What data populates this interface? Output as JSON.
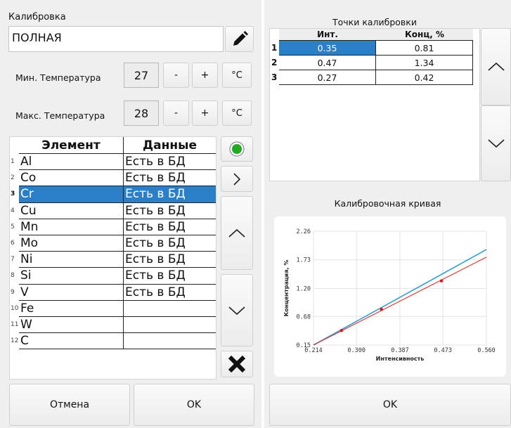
{
  "left": {
    "calibration_label": "Калибровка",
    "calibration_value": "ПОЛНАЯ",
    "min_temp_label": "Мин. Температура",
    "min_temp_value": "27",
    "max_temp_label": "Макс. Температура",
    "max_temp_value": "28",
    "minus": "-",
    "plus": "+",
    "unit": "°C",
    "table": {
      "headers": [
        "Элемент",
        "Данные"
      ],
      "rows": [
        {
          "n": "1",
          "el": "Al",
          "data": "Есть в БД"
        },
        {
          "n": "2",
          "el": "Co",
          "data": "Есть в БД"
        },
        {
          "n": "3",
          "el": "Cr",
          "data": "Есть в БД"
        },
        {
          "n": "4",
          "el": "Cu",
          "data": "Есть в БД"
        },
        {
          "n": "5",
          "el": "Mn",
          "data": "Есть в БД"
        },
        {
          "n": "6",
          "el": "Mo",
          "data": "Есть в БД"
        },
        {
          "n": "7",
          "el": "Ni",
          "data": "Есть в БД"
        },
        {
          "n": "8",
          "el": "Si",
          "data": "Есть в БД"
        },
        {
          "n": "9",
          "el": "V",
          "data": "Есть в БД"
        },
        {
          "n": "10",
          "el": "Fe",
          "data": ""
        },
        {
          "n": "11",
          "el": "W",
          "data": ""
        },
        {
          "n": "12",
          "el": "C",
          "data": ""
        }
      ],
      "selected_row": "3"
    },
    "cancel_label": "Отмена",
    "ok_label": "OK"
  },
  "right": {
    "points_title": "Точки калибровки",
    "points_headers": [
      "Инт.",
      "Конц, %"
    ],
    "points": [
      {
        "n": "1",
        "int": "0.35",
        "conc": "0.81"
      },
      {
        "n": "2",
        "int": "0.47",
        "conc": "1.34"
      },
      {
        "n": "3",
        "int": "0.27",
        "conc": "0.42"
      }
    ],
    "curve_title": "Калибровочная кривая",
    "ok_label": "OK"
  },
  "colors": {
    "selection": "#2b7fc8",
    "fit_line": "#2f9ed8",
    "calib_line": "#e0302a",
    "point": "#d8181f",
    "status_green": "#22aa22"
  },
  "chart_data": {
    "type": "line",
    "xlabel": "Интенсивность",
    "ylabel": "Концентрация, %",
    "xlim": [
      0.214,
      0.56
    ],
    "ylim": [
      0.15,
      2.26
    ],
    "xticks": [
      "0.214",
      "0.300",
      "0.387",
      "0.473",
      "0.560"
    ],
    "yticks": [
      "0.15",
      "0.68",
      "1.20",
      "1.73",
      "2.26"
    ],
    "series": [
      {
        "color": "#2f9ed8",
        "x": [
          0.214,
          0.56
        ],
        "y": [
          0.15,
          1.92
        ]
      },
      {
        "color": "#e0302a",
        "x": [
          0.214,
          0.56
        ],
        "y": [
          0.15,
          1.78
        ]
      },
      {
        "color": "#d8181f",
        "type": "scatter",
        "x": [
          0.27,
          0.35,
          0.47
        ],
        "y": [
          0.42,
          0.81,
          1.34
        ]
      }
    ],
    "grid": true
  }
}
